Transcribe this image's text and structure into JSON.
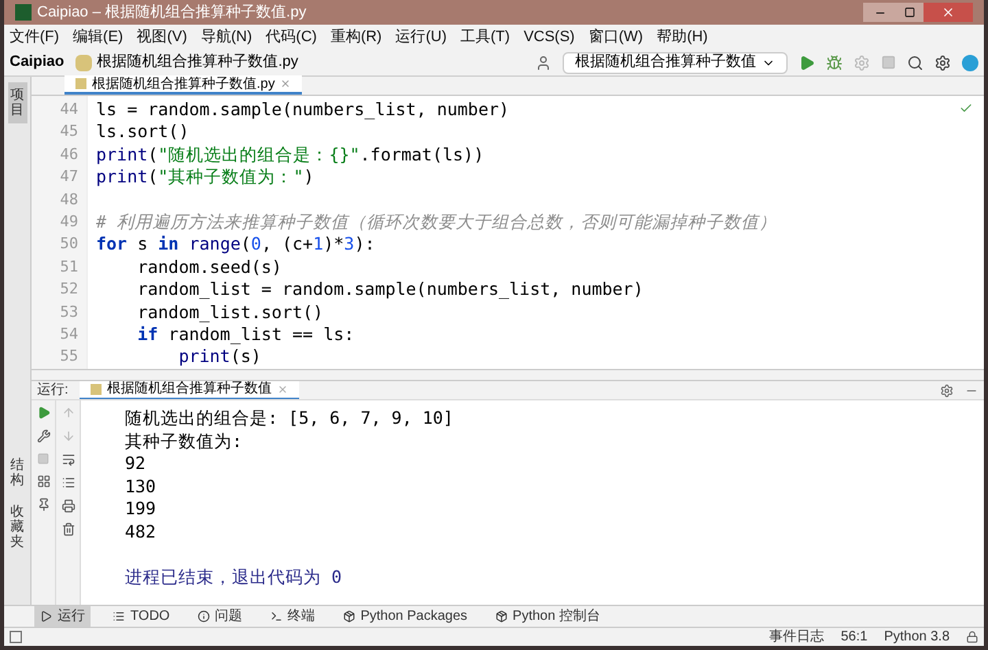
{
  "window": {
    "title": "Caipiao – 根据随机组合推算种子数值.py"
  },
  "menu": [
    "文件(F)",
    "编辑(E)",
    "视图(V)",
    "导航(N)",
    "代码(C)",
    "重构(R)",
    "运行(U)",
    "工具(T)",
    "VCS(S)",
    "窗口(W)",
    "帮助(H)"
  ],
  "breadcrumb": {
    "project": "Caipiao",
    "file": "根据随机组合推算种子数值.py"
  },
  "run_config": "根据随机组合推算种子数值",
  "left_strip": {
    "top": "项目",
    "bottom": [
      "结构",
      "收藏夹"
    ]
  },
  "editor": {
    "tab": {
      "label": "根据随机组合推算种子数值.py",
      "selected": true
    },
    "lines": [
      {
        "number": "44",
        "tokens": [
          {
            "kind": "plain",
            "text": "ls = random.sample(numbers_list, number)"
          }
        ]
      },
      {
        "number": "45",
        "tokens": [
          {
            "kind": "plain",
            "text": "ls.sort()"
          }
        ]
      },
      {
        "number": "46",
        "tokens": [
          {
            "kind": "builtin",
            "text": "print"
          },
          {
            "kind": "plain",
            "text": "("
          },
          {
            "kind": "string",
            "text": "\"随机选出的组合是：{}\""
          },
          {
            "kind": "plain",
            "text": ".format(ls))"
          }
        ]
      },
      {
        "number": "47",
        "tokens": [
          {
            "kind": "builtin",
            "text": "print"
          },
          {
            "kind": "plain",
            "text": "("
          },
          {
            "kind": "string",
            "text": "\"其种子数值为：\""
          },
          {
            "kind": "plain",
            "text": ")"
          }
        ]
      },
      {
        "number": "48"
      },
      {
        "number": "49",
        "tokens": [
          {
            "kind": "comment",
            "text": "# 利用遍历方法来推算种子数值（循环次数要大于组合总数，否则可能漏掉种子数值）"
          }
        ]
      },
      {
        "number": "50",
        "tokens": [
          {
            "kind": "keyword",
            "text": "for"
          },
          {
            "kind": "plain",
            "text": " s "
          },
          {
            "kind": "keyword",
            "text": "in"
          },
          {
            "kind": "builtin",
            "text": " range"
          },
          {
            "kind": "plain",
            "text": "("
          },
          {
            "kind": "number",
            "text": "0"
          },
          {
            "kind": "plain",
            "text": ", (c+"
          },
          {
            "kind": "number",
            "text": "1"
          },
          {
            "kind": "plain",
            "text": ")*"
          },
          {
            "kind": "number",
            "text": "3"
          },
          {
            "kind": "plain",
            "text": "):"
          }
        ]
      },
      {
        "number": "51",
        "tokens": [
          {
            "kind": "plain",
            "text": "    random.seed(s)"
          }
        ]
      },
      {
        "number": "52",
        "tokens": [
          {
            "kind": "plain",
            "text": "    random_list = random.sample(numbers_list, number)"
          }
        ]
      },
      {
        "number": "53",
        "tokens": [
          {
            "kind": "plain",
            "text": "    random_list.sort()"
          }
        ]
      },
      {
        "number": "54",
        "tokens": [
          {
            "kind": "keyword",
            "text": "    if"
          },
          {
            "kind": "plain",
            "text": " random_list == ls:"
          }
        ]
      },
      {
        "number": "55",
        "tokens": [
          {
            "kind": "builtin",
            "text": "        print"
          },
          {
            "kind": "plain",
            "text": "(s)"
          }
        ]
      }
    ]
  },
  "run_panel": {
    "label": "运行:",
    "tab": {
      "label": "根据随机组合推算种子数值",
      "selected": true
    },
    "output": [
      {
        "kind": "stdout",
        "text": "随机选出的组合是: [5, 6, 7, 9, 10]"
      },
      {
        "kind": "stdout",
        "text": "其种子数值为:"
      },
      {
        "kind": "stdout",
        "text": "92"
      },
      {
        "kind": "stdout",
        "text": "130"
      },
      {
        "kind": "stdout",
        "text": "199"
      },
      {
        "kind": "stdout",
        "text": "482"
      },
      {
        "kind": "system",
        "text": "进程已结束，退出代码为 0"
      }
    ]
  },
  "tool_tabs": [
    {
      "label": "运行",
      "selected": true
    },
    {
      "label": "TODO",
      "selected": false
    },
    {
      "label": "问题",
      "selected": false
    },
    {
      "label": "终端",
      "selected": false
    },
    {
      "label": "Python Packages",
      "selected": false
    },
    {
      "label": "Python 控制台",
      "selected": false
    }
  ],
  "status_bar": {
    "event_log": "事件日志",
    "position": "56:1",
    "interpreter": "Python 3.8"
  }
}
